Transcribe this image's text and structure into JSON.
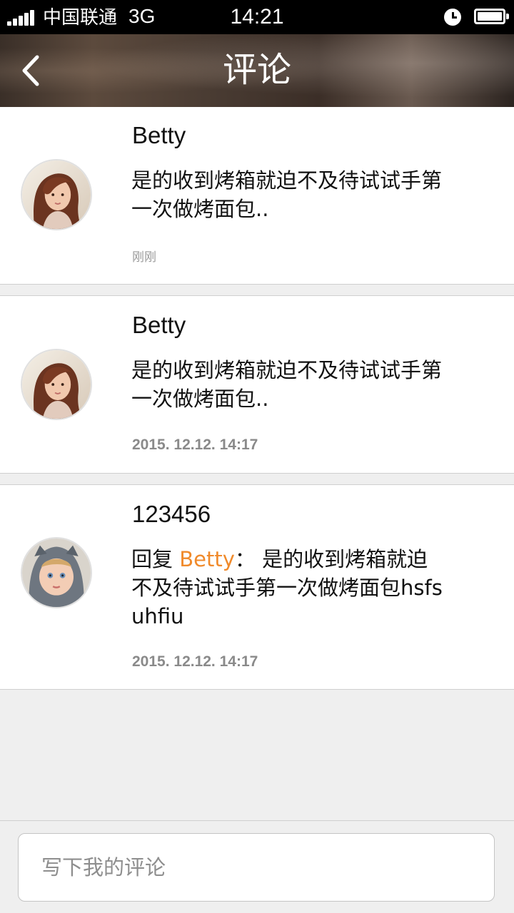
{
  "status_bar": {
    "carrier": "中国联通",
    "network": "3G",
    "time": "14:21"
  },
  "header": {
    "title": "评论",
    "back_icon": "chevron-left-icon"
  },
  "comments": [
    {
      "name": "Betty",
      "text": "是的收到烤箱就迫不及待试试手第一次做烤面包..",
      "time": "刚刚",
      "avatar": "girl-portrait"
    },
    {
      "name": "Betty",
      "text": "是的收到烤箱就迫不及待试试手第一次做烤面包..",
      "time": "2015. 12.12. 14:17",
      "avatar": "girl-portrait"
    },
    {
      "name": "123456",
      "reply_prefix": "回复 ",
      "reply_to": "Betty",
      "reply_sep": "： ",
      "text": "是的收到烤箱就迫不及待试试手第一次做烤面包hsfsuhfiu",
      "time": "2015. 12.12. 14:17",
      "avatar": "boy-portrait"
    }
  ],
  "input": {
    "placeholder": "写下我的评论"
  },
  "colors": {
    "accent": "#f08a2b",
    "status_bar": "#000000",
    "background": "#efefef"
  }
}
